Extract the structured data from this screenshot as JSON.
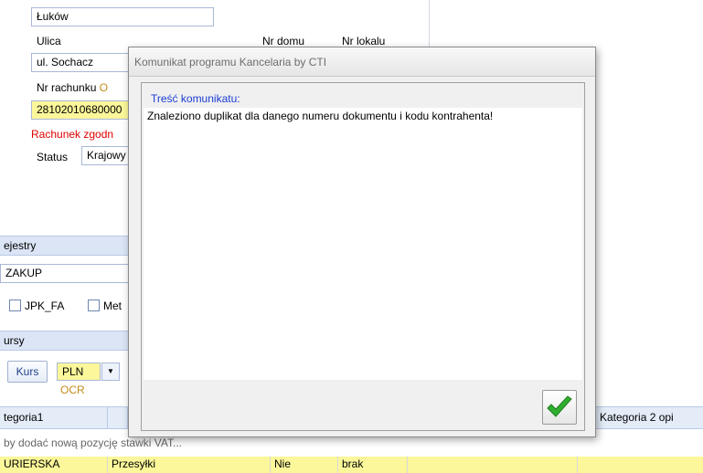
{
  "form": {
    "city_value": "Łuków",
    "street_label": "Ulica",
    "house_label": "Nr domu",
    "flat_label": "Nr lokalu",
    "street_value": "ul. Sochacz",
    "account_label": "Nr rachunku",
    "account_suffix": "O",
    "account_value": "28102010680000",
    "account_status": "Rachunek zgodn",
    "status_label": "Status",
    "status_value": "Krajowy"
  },
  "registers": {
    "title": "ejestry",
    "value": "ZAKUP",
    "jpk_label": "JPK_FA",
    "met_label": "Met"
  },
  "rates": {
    "title": "ursy",
    "kurs_button": "Kurs",
    "currency": "PLN",
    "ocr_label": "OCR"
  },
  "grid": {
    "headers": [
      "tegoria1",
      "Kategoria 2 opi"
    ],
    "hint": "by dodać nową pozycję stawki VAT...",
    "row": [
      "URIERSKA",
      "Przesyłki",
      "Nie",
      "brak"
    ]
  },
  "dialog": {
    "title": "Komunikat programu Kancelaria by CTI",
    "content_label": "Treść komunikatu:",
    "message": "Znaleziono duplikat dla danego numeru dokumentu i kodu kontrahenta!"
  },
  "colors": {
    "accent": "#1a3dd1",
    "warning": "#e00000",
    "ocr": "#c28a1b",
    "ok_check": "#2fae2f"
  }
}
